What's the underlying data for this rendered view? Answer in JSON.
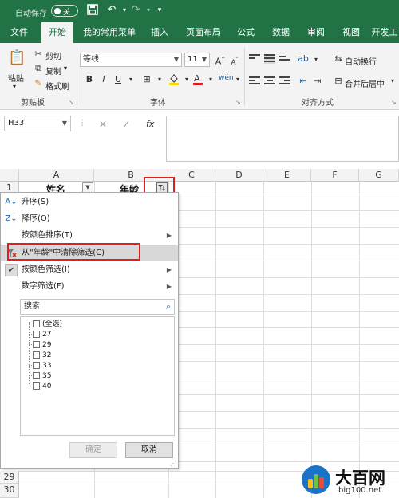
{
  "titlebar": {
    "autosave_label": "自动保存",
    "autosave_state": "关"
  },
  "ribbon_tabs": [
    "文件",
    "开始",
    "我的常用菜单",
    "插入",
    "页面布局",
    "公式",
    "数据",
    "审阅",
    "视图",
    "开发工"
  ],
  "active_tab": "开始",
  "clipboard": {
    "paste": "粘贴",
    "cut": "剪切",
    "copy": "复制",
    "format_painter": "格式刷",
    "group": "剪贴板"
  },
  "font": {
    "name": "等线",
    "size": "11",
    "group": "字体",
    "bold": "B",
    "italic": "I",
    "underline": "U"
  },
  "alignment": {
    "wrap_text": "自动换行",
    "merge_center": "合并后居中",
    "group": "对齐方式"
  },
  "formula_bar": {
    "name_box": "H33",
    "fx": "fx",
    "formula": ""
  },
  "columns": [
    "A",
    "B",
    "C",
    "D",
    "E",
    "F",
    "G"
  ],
  "rows": {
    "r1": "1",
    "r29": "29",
    "r30": "30"
  },
  "header_cells": {
    "a1": "姓名",
    "b1": "年龄"
  },
  "filter_menu": {
    "sort_asc": "升序(S)",
    "sort_desc": "降序(O)",
    "sort_by_color": "按颜色排序(T)",
    "clear_filter": "从\"年龄\"中清除筛选(C)",
    "filter_by_color": "按颜色筛选(I)",
    "number_filter": "数字筛选(F)",
    "search_placeholder": "搜索",
    "items": [
      "(全选)",
      "27",
      "29",
      "32",
      "33",
      "35",
      "40"
    ],
    "ok": "确定",
    "cancel": "取消"
  },
  "watermark": {
    "title": "大百网",
    "url": "big100.net"
  },
  "colors": {
    "excel_green": "#217346",
    "highlight_red": "#e02020"
  }
}
